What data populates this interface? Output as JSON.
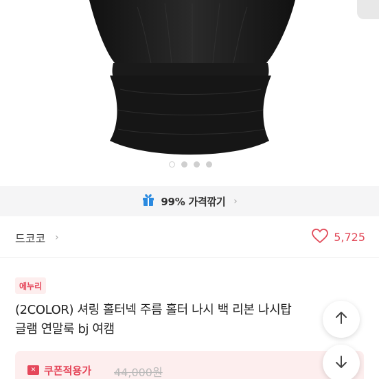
{
  "image": {
    "alt": "black ruched halter top product photo"
  },
  "carousel": {
    "total": 4,
    "active": 1
  },
  "price_cut": {
    "label": "99% 가격깎기",
    "icon": "gift-icon",
    "accent": "#2b8ae0"
  },
  "seller": {
    "name": "드코코",
    "likes": "5,725",
    "heart_color": "#e24a59"
  },
  "product": {
    "badge": "에누리",
    "title": "(2COLOR) 셔링 홀터넥 주름 홀터 나시 백 리본 나시탑 \n글램 연말룩 bj 여캠"
  },
  "coupon": {
    "label": "쿠폰적용가",
    "original_price": "44,000원",
    "accent": "#e5475a"
  },
  "scroll": {
    "up_icon": "arrow-up-icon",
    "down_icon": "arrow-down-icon"
  }
}
